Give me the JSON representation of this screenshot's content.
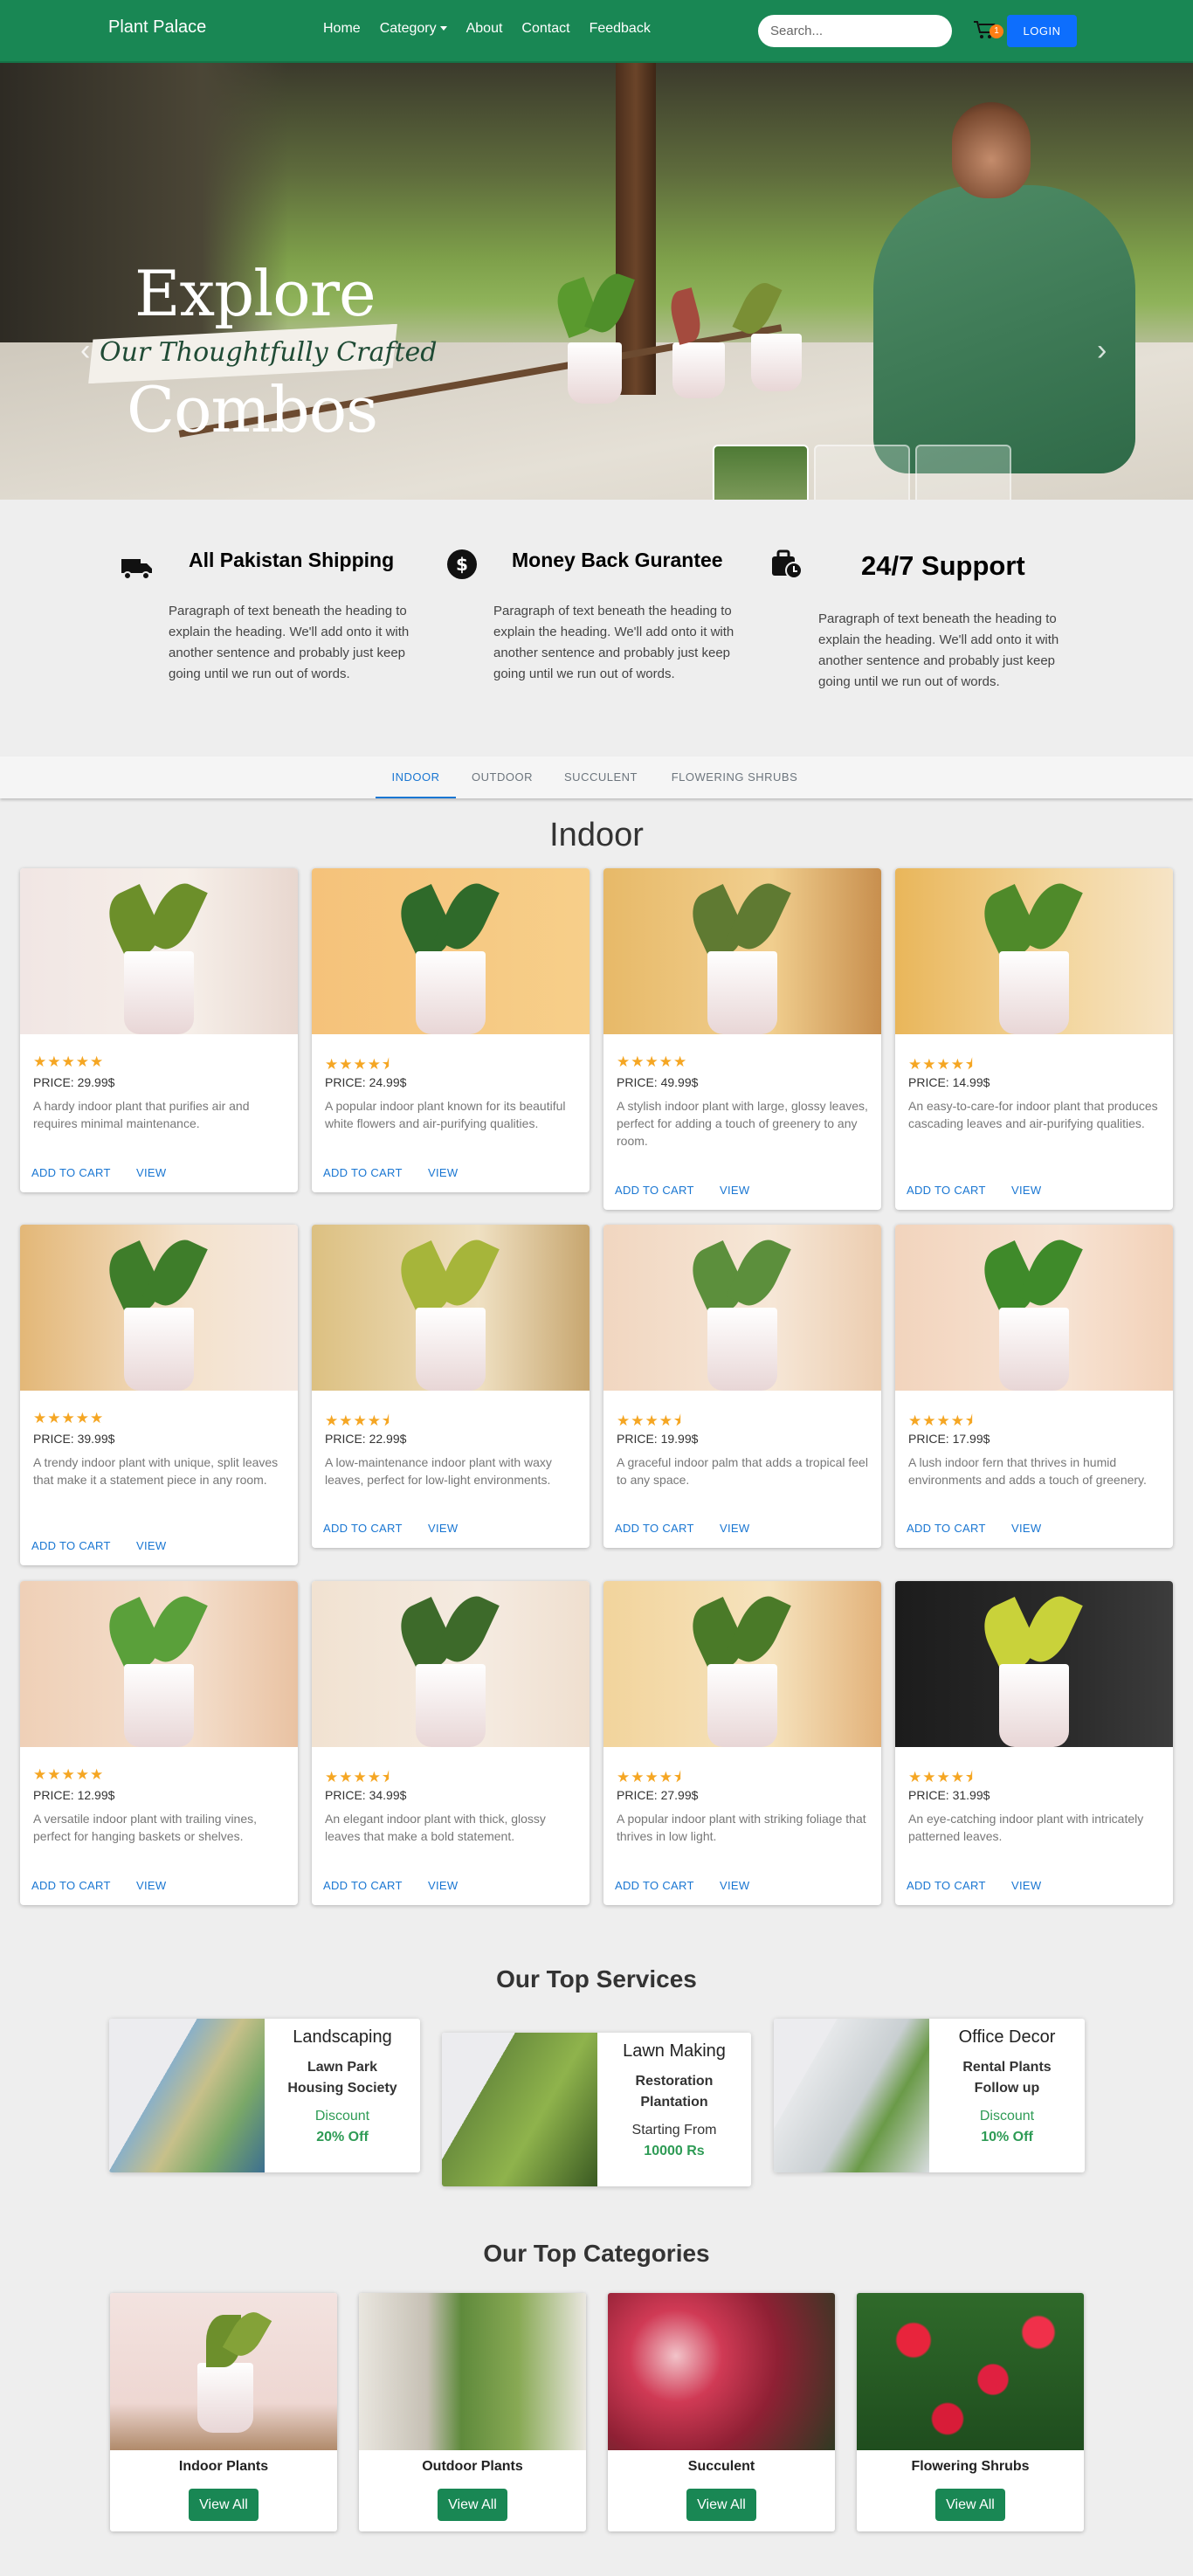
{
  "nav": {
    "brand": "Plant Palace",
    "links": [
      "Home",
      "Category",
      "About",
      "Contact",
      "Feedback"
    ],
    "search_placeholder": "Search...",
    "cart_count": "1",
    "login_label": "LOGIN",
    "color": "#198754"
  },
  "hero": {
    "line1": "Explore",
    "line2": "Our Thoughtfully Crafted",
    "line3": "Combos",
    "prev_icon": "‹",
    "next_icon": "›",
    "thumbnails": 3,
    "active_thumbnail": 1
  },
  "features": [
    {
      "icon": "truck-icon",
      "title": "All Pakistan Shipping",
      "text": "Paragraph of text beneath the heading to explain the heading. We'll add onto it with another sentence and probably just keep going until we run out of words."
    },
    {
      "icon": "dollar-icon",
      "title": "Money Back Gurantee",
      "text": "Paragraph of text beneath the heading to explain the heading. We'll add onto it with another sentence and probably just keep going until we run out of words."
    },
    {
      "icon": "clock-bag-icon",
      "title": "24/7 Support",
      "text": "Paragraph of text beneath the heading to explain the heading. We'll add onto it with another sentence and probably just keep going until we run out of words."
    }
  ],
  "tabs": [
    "INDOOR",
    "OUTDOOR",
    "SUCCULENT",
    "FLOWERING SHRUBS"
  ],
  "active_tab": "INDOOR",
  "section_title": "Indoor",
  "card_actions": {
    "add": "ADD TO CART",
    "view": "VIEW"
  },
  "products": [
    {
      "rating": 5,
      "price": "PRICE: 29.99$",
      "desc": "A hardy indoor plant that purifies air and requires minimal maintenance."
    },
    {
      "rating": 4.5,
      "price": "PRICE: 24.99$",
      "desc": "A popular indoor plant known for its beautiful white flowers and air-purifying qualities."
    },
    {
      "rating": 5,
      "price": "PRICE: 49.99$",
      "desc": "A stylish indoor plant with large, glossy leaves, perfect for adding a touch of greenery to any room."
    },
    {
      "rating": 4.5,
      "price": "PRICE: 14.99$",
      "desc": "An easy-to-care-for indoor plant that produces cascading leaves and air-purifying qualities."
    },
    {
      "rating": 5,
      "price": "PRICE: 39.99$",
      "desc": "A trendy indoor plant with unique, split leaves that make it a statement piece in any room."
    },
    {
      "rating": 4.5,
      "price": "PRICE: 22.99$",
      "desc": "A low-maintenance indoor plant with waxy leaves, perfect for low-light environments."
    },
    {
      "rating": 4.5,
      "price": "PRICE: 19.99$",
      "desc": "A graceful indoor palm that adds a tropical feel to any space."
    },
    {
      "rating": 4.5,
      "price": "PRICE: 17.99$",
      "desc": "A lush indoor fern that thrives in humid environments and adds a touch of greenery."
    },
    {
      "rating": 5,
      "price": "PRICE: 12.99$",
      "desc": "A versatile indoor plant with trailing vines, perfect for hanging baskets or shelves."
    },
    {
      "rating": 4.5,
      "price": "PRICE: 34.99$",
      "desc": "An elegant indoor plant with thick, glossy leaves that make a bold statement."
    },
    {
      "rating": 4.5,
      "price": "PRICE: 27.99$",
      "desc": "A popular indoor plant with striking foliage that thrives in low light."
    },
    {
      "rating": 4.5,
      "price": "PRICE: 31.99$",
      "desc": "An eye-catching indoor plant with intricately patterned leaves."
    }
  ],
  "services_title": "Our Top Services",
  "services": [
    {
      "title": "Landscaping",
      "sub": "Lawn Park Housing Society",
      "note1": "Discount",
      "note2": "20% Off"
    },
    {
      "title": "Lawn Making",
      "sub": "Restoration Plantation",
      "note1": "Starting From",
      "note2": "10000 Rs"
    },
    {
      "title": "Office Decor",
      "sub": "Rental Plants Follow up",
      "note1": "Discount",
      "note2": "10% Off"
    }
  ],
  "categories_title": "Our Top Categories",
  "categories": [
    {
      "name": "Indoor Plants",
      "button": "View All"
    },
    {
      "name": "Outdoor Plants",
      "button": "View All"
    },
    {
      "name": "Succulent",
      "button": "View All"
    },
    {
      "name": "Flowering Shrubs",
      "button": "View All"
    }
  ],
  "colors": {
    "primary": "#198754",
    "link": "#1976d2",
    "star": "#f5a623",
    "badge": "#fd7e14",
    "login": "#0d6efd"
  }
}
